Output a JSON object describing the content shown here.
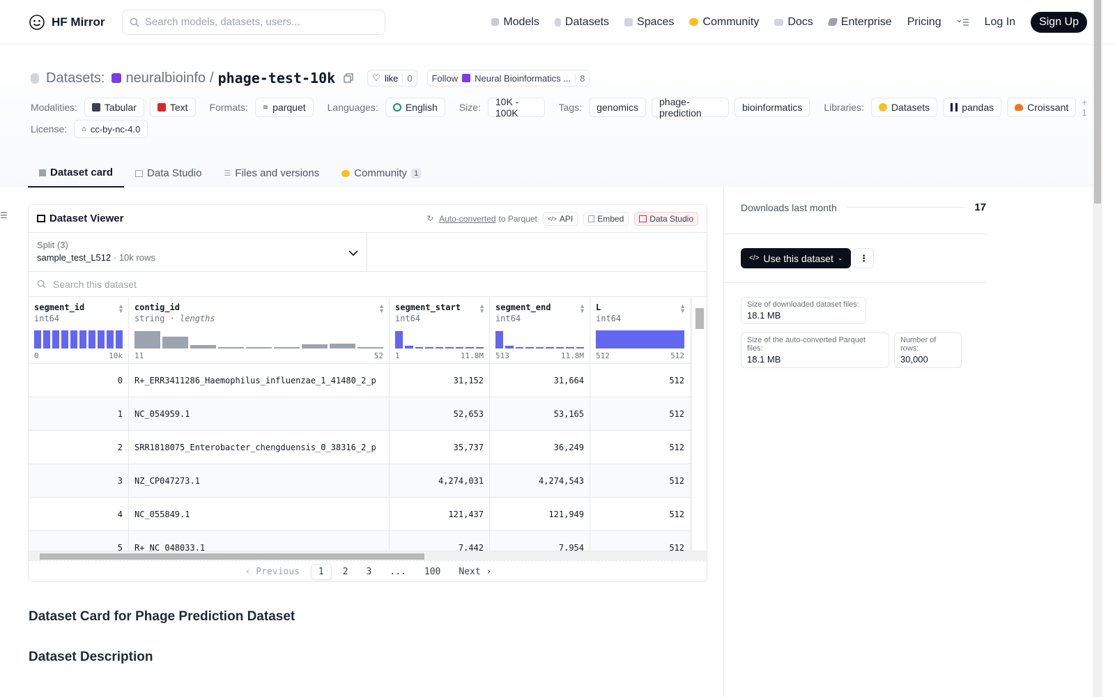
{
  "nav": {
    "brand": "HF Mirror",
    "search_placeholder": "Search models, datasets, users...",
    "links": [
      "Models",
      "Datasets",
      "Spaces",
      "Community",
      "Docs",
      "Enterprise",
      "Pricing"
    ],
    "login": "Log In",
    "signup": "Sign Up"
  },
  "header": {
    "prefix": "Datasets:",
    "org": "neuralbioinfo",
    "slash": "/",
    "repo": "phage-test-10k",
    "like_label": "like",
    "like_count": "0",
    "follow_label": "Follow",
    "follow_org": "Neural Bioinformatics ...",
    "follow_count": "8"
  },
  "meta": {
    "modalities_label": "Modalities:",
    "modalities": [
      "Tabular",
      "Text"
    ],
    "formats_label": "Formats:",
    "formats": [
      "parquet"
    ],
    "languages_label": "Languages:",
    "languages": [
      "English"
    ],
    "size_label": "Size:",
    "size": "10K - 100K",
    "tags_label": "Tags:",
    "tags": [
      "genomics",
      "phage-prediction",
      "bioinformatics"
    ],
    "libraries_label": "Libraries:",
    "libraries": [
      "Datasets",
      "pandas",
      "Croissant"
    ],
    "libraries_more": "+ 1",
    "license_label": "License:",
    "license": "cc-by-nc-4.0"
  },
  "tabs": [
    {
      "label": "Dataset card",
      "active": true
    },
    {
      "label": "Data Studio"
    },
    {
      "label": "Files and versions"
    },
    {
      "label": "Community",
      "badge": "1"
    }
  ],
  "viewer": {
    "title": "Dataset Viewer",
    "auto_converted": "Auto-converted",
    "to_parquet": "to Parquet",
    "api": "API",
    "embed": "Embed",
    "data_studio": "Data Studio",
    "split_label": "Split (3)",
    "split_value": "sample_test_L512",
    "split_rows": "10k rows",
    "search_placeholder": "Search this dataset",
    "columns": [
      {
        "name": "segment_id",
        "type": "int64",
        "min": "0",
        "max": "10k",
        "hist": [
          1,
          1,
          1,
          1,
          1,
          1,
          1,
          1,
          1,
          1
        ]
      },
      {
        "name": "contig_id",
        "type": "string",
        "subtype": "lengths",
        "min": "11",
        "max": "52",
        "hist": [
          0.95,
          0.65,
          0.2,
          0.05,
          0.08,
          0.08,
          0.22,
          0.28,
          0.03
        ]
      },
      {
        "name": "segment_start",
        "type": "int64",
        "min": "1",
        "max": "11.8M",
        "hist": [
          0.95,
          0.15,
          0.08,
          0.05,
          0.04,
          0.04,
          0.04,
          0.03,
          0.03
        ]
      },
      {
        "name": "segment_end",
        "type": "int64",
        "min": "513",
        "max": "11.8M",
        "hist": [
          0.95,
          0.15,
          0.08,
          0.05,
          0.04,
          0.04,
          0.04,
          0.03,
          0.03
        ]
      },
      {
        "name": "L",
        "type": "int64",
        "min": "512",
        "max": "512",
        "hist": [
          1
        ]
      }
    ],
    "rows": [
      [
        "0",
        "R+_ERR3411286_Haemophilus_influenzae_1_41480_2_p",
        "31,152",
        "31,664",
        "512"
      ],
      [
        "1",
        "NC_054959.1",
        "52,653",
        "53,165",
        "512"
      ],
      [
        "2",
        "SRR1818075_Enterobacter_chengduensis_0_38316_2_p",
        "35,737",
        "36,249",
        "512"
      ],
      [
        "3",
        "NZ_CP047273.1",
        "4,274,031",
        "4,274,543",
        "512"
      ],
      [
        "4",
        "NC_055849.1",
        "121,437",
        "121,949",
        "512"
      ],
      [
        "5",
        "R+_NC_048033.1",
        "7,442",
        "7,954",
        "512"
      ]
    ],
    "pager": {
      "prev": "Previous",
      "pages": [
        "1",
        "2",
        "3",
        "...",
        "100"
      ],
      "next": "Next"
    }
  },
  "card": {
    "h1": "Dataset Card for Phage Prediction Dataset",
    "h2": "Dataset Description"
  },
  "sidebar": {
    "downloads_label": "Downloads last month",
    "downloads": "17",
    "use_button": "Use this dataset",
    "size_dl_label": "Size of downloaded dataset files:",
    "size_dl": "18.1 MB",
    "size_parquet_label": "Size of the auto-converted Parquet files:",
    "size_parquet": "18.1 MB",
    "rows_label": "Number of rows:",
    "rows": "30,000"
  },
  "colors": {
    "accent": "#6366f1",
    "dark": "#0b0f19",
    "border": "#e5e7eb"
  }
}
